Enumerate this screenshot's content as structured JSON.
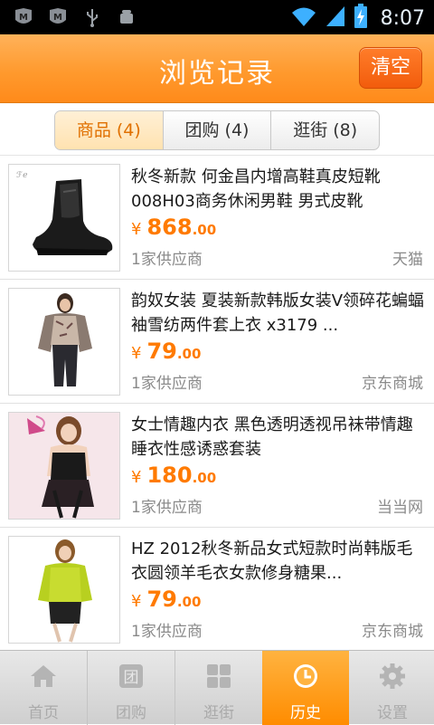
{
  "status_bar": {
    "time": "8:07",
    "left_icons": [
      "m-app-icon",
      "m-app-icon-2",
      "usb-icon",
      "android-debug-icon"
    ],
    "right_icons": [
      "wifi-icon",
      "signal-icon",
      "battery-charging-icon"
    ]
  },
  "header": {
    "title": "浏览记录",
    "clear_label": "清空"
  },
  "tabs": [
    {
      "label": "商品 (4)",
      "active": true
    },
    {
      "label": "团购 (4)",
      "active": false
    },
    {
      "label": "逛街 (8)",
      "active": false
    }
  ],
  "items": [
    {
      "title": "秋冬新款 何金昌内增高鞋真皮短靴008H03商务休闲男鞋 男式皮靴",
      "currency": "¥",
      "price_int": "868",
      "price_dec": ".00",
      "suppliers": "1家供应商",
      "store": "天猫",
      "image": "black-leather-boot"
    },
    {
      "title": "韵奴女装 夏装新款韩版女装V领碎花蝙蝠袖雪纺两件套上衣 x3179 ...",
      "currency": "¥",
      "price_int": "79",
      "price_dec": ".00",
      "suppliers": "1家供应商",
      "store": "京东商城",
      "image": "floral-chiffon-top"
    },
    {
      "title": "女士情趣内衣 黑色透明透视吊袜带情趣睡衣性感诱惑套装",
      "currency": "¥",
      "price_int": "180",
      "price_dec": ".00",
      "suppliers": "1家供应商",
      "store": "当当网",
      "image": "black-lingerie-set"
    },
    {
      "title": "HZ 2012秋冬新品女式短款时尚韩版毛衣圆领羊毛衣女款修身糖果...",
      "currency": "¥",
      "price_int": "79",
      "price_dec": ".00",
      "suppliers": "1家供应商",
      "store": "京东商城",
      "image": "green-sweater"
    }
  ],
  "bottom_nav": [
    {
      "label": "首页",
      "icon": "home-icon",
      "active": false
    },
    {
      "label": "团购",
      "icon": "group-buy-icon",
      "active": false
    },
    {
      "label": "逛街",
      "icon": "grid-icon",
      "active": false
    },
    {
      "label": "历史",
      "icon": "clock-icon",
      "active": true
    },
    {
      "label": "设置",
      "icon": "gear-icon",
      "active": false
    }
  ],
  "colors": {
    "header_orange": "#ff9a2e",
    "accent_orange": "#ff7a00",
    "clear_button": "#f25c0c",
    "muted_text": "#8a8a8a"
  }
}
